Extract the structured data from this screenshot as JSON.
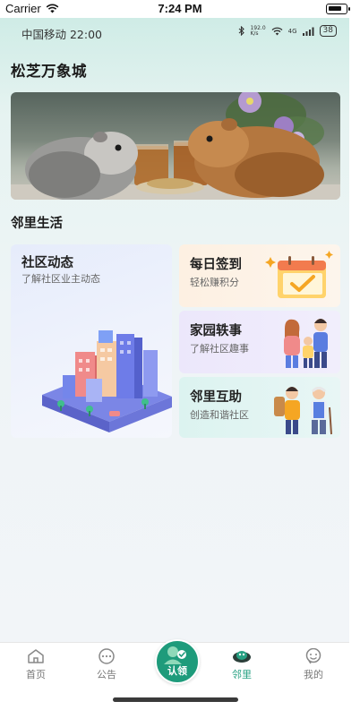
{
  "ios_status": {
    "carrier": "Carrier",
    "time": "7:24 PM"
  },
  "phone_status": {
    "carrier_time": "中国移动 22:00",
    "speed": "192.0\nK/s",
    "network": "4G",
    "battery": "38"
  },
  "header": {
    "title": "松芝万象城"
  },
  "banner": {
    "alt": "两只豚鼠与茶杯"
  },
  "section": {
    "title": "邻里生活"
  },
  "cards": {
    "community": {
      "title": "社区动态",
      "subtitle": "了解社区业主动态"
    },
    "checkin": {
      "title": "每日签到",
      "subtitle": "轻松赚积分"
    },
    "stories": {
      "title": "家园轶事",
      "subtitle": "了解社区趣事"
    },
    "help": {
      "title": "邻里互助",
      "subtitle": "创造和谐社区"
    }
  },
  "tabbar": {
    "home": "首页",
    "notice": "公告",
    "claim": "认领",
    "neighbor": "邻里",
    "mine": "我的",
    "active": "neighbor",
    "accent_color": "#26a082"
  }
}
